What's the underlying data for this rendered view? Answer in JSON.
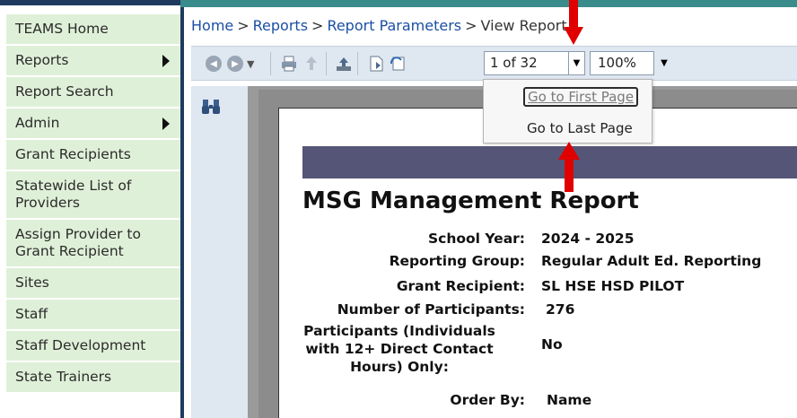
{
  "sidebar": {
    "items": [
      {
        "label": "TEAMS Home",
        "has_submenu": false
      },
      {
        "label": "Reports",
        "has_submenu": true
      },
      {
        "label": "Report Search",
        "has_submenu": false
      },
      {
        "label": "Admin",
        "has_submenu": true
      },
      {
        "label": "Grant Recipients",
        "has_submenu": false
      },
      {
        "label": "Statewide List of Providers",
        "has_submenu": false
      },
      {
        "label": "Assign Provider to Grant Recipient",
        "has_submenu": false
      },
      {
        "label": "Sites",
        "has_submenu": false
      },
      {
        "label": "Staff",
        "has_submenu": false
      },
      {
        "label": "Staff Development",
        "has_submenu": false
      },
      {
        "label": "State Trainers",
        "has_submenu": false
      }
    ]
  },
  "breadcrumb": {
    "home": "Home",
    "reports": "Reports",
    "report_parameters": "Report Parameters",
    "current": "View Report",
    "separator": ">"
  },
  "toolbar": {
    "page_indicator": "1 of 32",
    "zoom": "100%",
    "icons": [
      "back-icon",
      "forward-icon",
      "print-icon",
      "export-icon",
      "upload-icon",
      "page-icon",
      "refresh-icon"
    ]
  },
  "page_menu": {
    "first": "Go to First Page",
    "last": "Go to Last Page"
  },
  "report": {
    "title": "MSG Management Report",
    "fields": [
      {
        "label": "School Year:",
        "value": "2024 - 2025"
      },
      {
        "label": "Reporting Group:",
        "value": "Regular Adult Ed. Reporting"
      },
      {
        "label": "Grant Recipient:",
        "value": "SL HSE HSD PILOT"
      },
      {
        "label": "Number of Participants:",
        "value": "276"
      },
      {
        "label": "Participants (Individuals with 12+ Direct Contact Hours) Only:",
        "value": "No"
      },
      {
        "label": "Order By:",
        "value": "Name"
      }
    ]
  },
  "colors": {
    "sidebar_bg": "#dff0d8",
    "banner": "#555577",
    "annotation_arrow": "#e00000",
    "link": "#1a4fa3"
  }
}
